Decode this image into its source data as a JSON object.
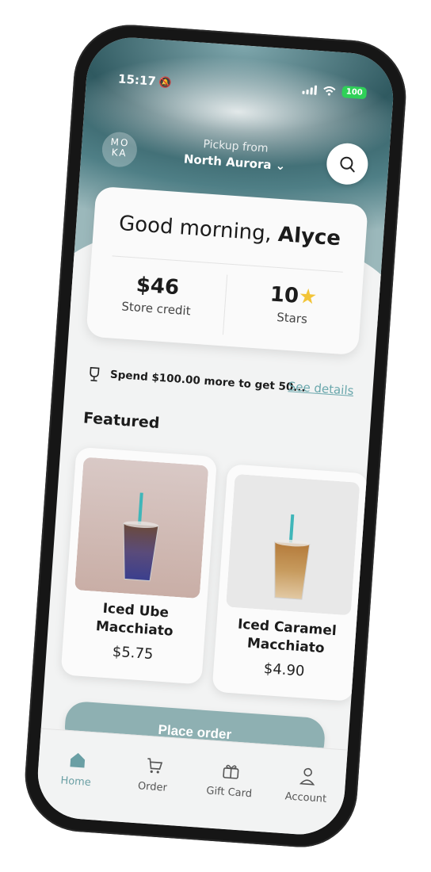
{
  "status_bar": {
    "time": "15:17",
    "battery": "100"
  },
  "header": {
    "logo_text": "MO KA",
    "pickup_label": "Pickup from",
    "pickup_location": "North Aurora",
    "location_chevron": "⌄"
  },
  "summary": {
    "greeting_prefix": "Good morning,",
    "user_name": "Alyce",
    "store_credit_value": "$46",
    "store_credit_label": "Store credit",
    "stars_value": "10",
    "stars_label": "Stars"
  },
  "promo": {
    "text": "Spend $100.00 more to get 50...",
    "link_label": "See details"
  },
  "featured": {
    "title": "Featured",
    "items": [
      {
        "name": "Iced Ube Macchiato",
        "price": "$5.75"
      },
      {
        "name": "Iced Caramel Macchiato",
        "price": "$4.90"
      }
    ]
  },
  "cta": {
    "label": "Place order"
  },
  "tabbar": {
    "items": [
      {
        "label": "Home",
        "icon": "home-icon",
        "active": true
      },
      {
        "label": "Order",
        "icon": "cart-icon",
        "active": false
      },
      {
        "label": "Gift Card",
        "icon": "gift-icon",
        "active": false
      },
      {
        "label": "Account",
        "icon": "person-icon",
        "active": false
      }
    ]
  },
  "colors": {
    "accent": "#8eb0b2",
    "link": "#6aa7ac",
    "star": "#f2c438",
    "battery": "#2fd158",
    "device_frame": "#161616"
  }
}
